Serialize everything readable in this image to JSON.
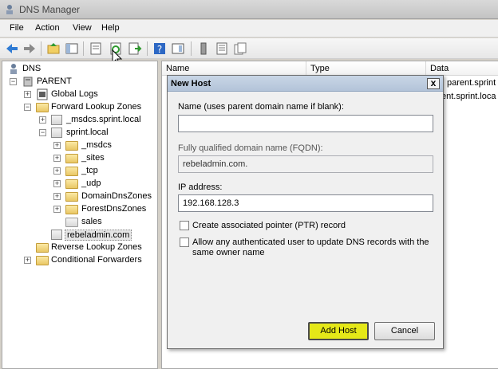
{
  "window": {
    "title": "DNS Manager"
  },
  "menu": [
    "File",
    "Action",
    "View",
    "Help"
  ],
  "tree": {
    "root": "DNS",
    "server": "PARENT",
    "items": [
      {
        "label": "Global Logs"
      },
      {
        "label": "Forward Lookup Zones"
      },
      {
        "label": "_msdcs.sprint.local"
      },
      {
        "label": "sprint.local"
      },
      {
        "label": "_msdcs"
      },
      {
        "label": "_sites"
      },
      {
        "label": "_tcp"
      },
      {
        "label": "_udp"
      },
      {
        "label": "DomainDnsZones"
      },
      {
        "label": "ForestDnsZones"
      },
      {
        "label": "sales"
      },
      {
        "label": "rebeladmin.com"
      },
      {
        "label": "Reverse Lookup Zones"
      },
      {
        "label": "Conditional Forwarders"
      }
    ]
  },
  "list": {
    "columns": [
      "Name",
      "Type",
      "Data"
    ],
    "rows": [
      {
        "data": "parent.sprint"
      },
      {
        "data": "ent.sprint.loca"
      }
    ]
  },
  "dialog": {
    "title": "New Host",
    "name_label": "Name (uses parent domain name if blank):",
    "name_value": "",
    "fqdn_label": "Fully qualified domain name (FQDN):",
    "fqdn_value": "rebeladmin.com.",
    "ip_label": "IP address:",
    "ip_value": "192.168.128.3",
    "ptr_label": "Create associated pointer (PTR) record",
    "auth_label_line1": "Allow any authenticated user to update DNS records with the",
    "auth_label_line2": "same owner name",
    "add_button": "Add Host",
    "cancel_button": "Cancel",
    "close_glyph": "x"
  },
  "colors": {
    "primary_button": "#e5e818",
    "dialog_title": "#b3c4d9"
  }
}
